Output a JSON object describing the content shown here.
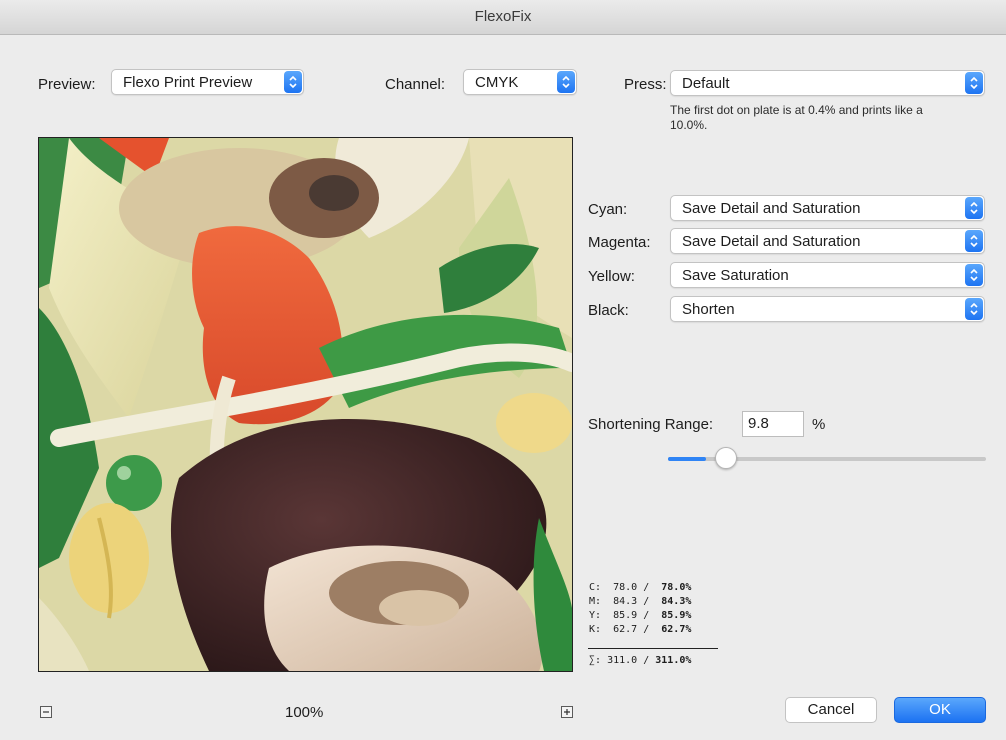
{
  "window": {
    "title": "FlexoFix"
  },
  "preview_select": {
    "label": "Preview:",
    "value": "Flexo Print Preview"
  },
  "channel_select": {
    "label": "Channel:",
    "value": "CMYK"
  },
  "press_select": {
    "label": "Press:",
    "value": "Default",
    "note_line1": "The first dot on plate is at 0.4% and prints like a",
    "note_line2": "10.0%."
  },
  "channels": [
    {
      "label": "Cyan:",
      "value": "Save Detail and Saturation"
    },
    {
      "label": "Magenta:",
      "value": "Save Detail and Saturation"
    },
    {
      "label": "Yellow:",
      "value": "Save Saturation"
    },
    {
      "label": "Black:",
      "value": "Shorten"
    }
  ],
  "shortening": {
    "label": "Shortening Range:",
    "value": "9.8",
    "unit": "%",
    "slider_fraction": 0.12
  },
  "readout": {
    "c": {
      "label": "C:",
      "a": "78.0 /",
      "b": "78.0%"
    },
    "m": {
      "label": "M:",
      "a": "84.3 /",
      "b": "84.3%"
    },
    "y": {
      "label": "Y:",
      "a": "85.9 /",
      "b": "85.9%"
    },
    "k": {
      "label": "K:",
      "a": "62.7 /",
      "b": "62.7%"
    },
    "sum": {
      "label": "∑:",
      "a": "311.0 /",
      "b": "311.0%"
    }
  },
  "zoom": {
    "level": "100%",
    "out_icon": "zoom-out-icon",
    "in_icon": "zoom-in-icon"
  },
  "buttons": {
    "cancel": "Cancel",
    "ok": "OK"
  },
  "colors": {
    "accent": "#2f84f5"
  }
}
